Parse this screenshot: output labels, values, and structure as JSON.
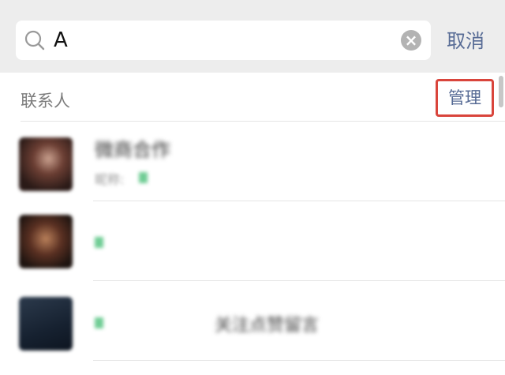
{
  "search": {
    "query": "A",
    "cancel_label": "取消",
    "icons": {
      "search": "search-icon",
      "clear": "clear-icon"
    }
  },
  "section": {
    "title": "联系人",
    "manage_label": "管理"
  },
  "contacts": [
    {
      "name": "微商合作",
      "subtitle": "昵称:"
    },
    {
      "name": ""
    },
    {
      "name": "",
      "overlay_text": "关注点赞留言"
    }
  ],
  "colors": {
    "link": "#576b95",
    "highlight_border": "#d9453c",
    "match_highlight": "#4cc07a",
    "search_bar_bg": "#ededed"
  }
}
